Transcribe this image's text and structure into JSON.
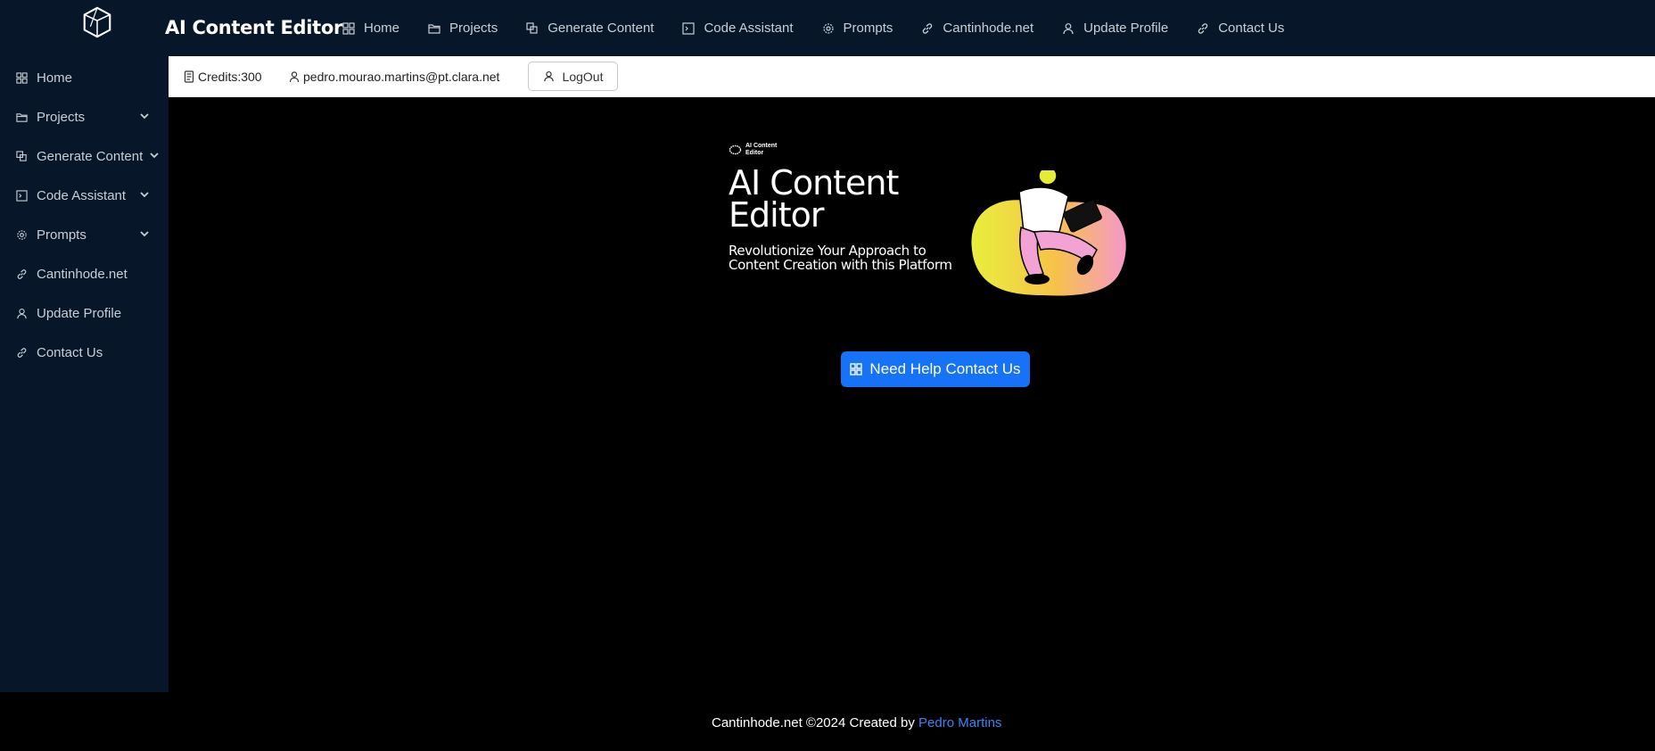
{
  "app": {
    "title": "AI Content Editor"
  },
  "topnav": [
    {
      "label": "Home",
      "icon": "grid-icon"
    },
    {
      "label": "Projects",
      "icon": "folder-icon"
    },
    {
      "label": "Generate Content",
      "icon": "layers-icon"
    },
    {
      "label": "Code Assistant",
      "icon": "terminal-icon"
    },
    {
      "label": "Prompts",
      "icon": "gear-icon"
    },
    {
      "label": "Cantinhode.net",
      "icon": "link-icon"
    },
    {
      "label": "Update Profile",
      "icon": "user-icon"
    },
    {
      "label": "Contact Us",
      "icon": "link-icon"
    }
  ],
  "sidebar": {
    "items": [
      {
        "label": "Home",
        "icon": "grid-icon",
        "expandable": false
      },
      {
        "label": "Projects",
        "icon": "folder-icon",
        "expandable": true
      },
      {
        "label": "Generate Content",
        "icon": "layers-icon",
        "expandable": true
      },
      {
        "label": "Code Assistant",
        "icon": "terminal-icon",
        "expandable": true
      },
      {
        "label": "Prompts",
        "icon": "gear-icon",
        "expandable": true
      },
      {
        "label": "Cantinhode.net",
        "icon": "link-icon",
        "expandable": false
      },
      {
        "label": "Update Profile",
        "icon": "user-icon",
        "expandable": false
      },
      {
        "label": "Contact Us",
        "icon": "link-icon",
        "expandable": false
      }
    ]
  },
  "infobar": {
    "credits": "Credits:300",
    "email": "pedro.mourao.martins@pt.clara.net",
    "logout_label": "LogOut"
  },
  "banner": {
    "mini_brand": "AI Content Editor",
    "title_line1": "AI Content",
    "title_line2": "Editor",
    "subtitle_line1": "Revolutionize Your Approach to",
    "subtitle_line2": "Content Creation with this Platform"
  },
  "main": {
    "help_button_label": "Need Help Contact Us"
  },
  "footer": {
    "text": "Cantinhode.net ©2024 Created by ",
    "link_label": "Pedro Martins"
  },
  "colors": {
    "nav_bg": "#071729",
    "accent": "#1672f6",
    "link": "#3b82f6"
  }
}
